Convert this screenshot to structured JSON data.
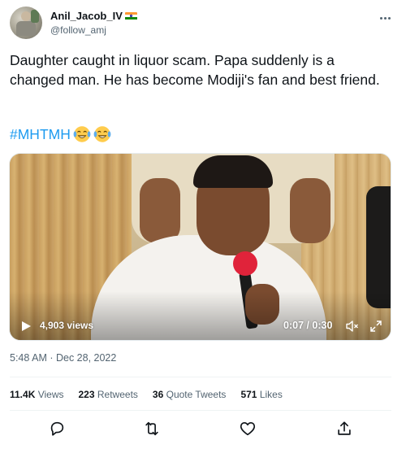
{
  "tweet": {
    "author": {
      "display_name": "Anil_Jacob_IV",
      "handle": "@follow_amj",
      "flag_icon": "india-flag-icon"
    },
    "text": "Daughter caught in liquor scam. Papa suddenly is a changed man. He has become Modiji's fan and best friend.",
    "hashtag": "#MHTMH",
    "emojis": [
      "face-with-tears-of-joy",
      "face-with-tears-of-joy"
    ],
    "video": {
      "views": "4,903 views",
      "timecode": "0:07 / 0:30"
    },
    "timestamp": "5:48 AM · Dec 28, 2022",
    "stats": [
      {
        "value": "11.4K",
        "label": "Views"
      },
      {
        "value": "223",
        "label": "Retweets"
      },
      {
        "value": "36",
        "label": "Quote Tweets"
      },
      {
        "value": "571",
        "label": "Likes"
      }
    ]
  },
  "colors": {
    "hashtag": "#1d9bf0",
    "secondary_text": "#536471",
    "primary_text": "#0f1419"
  }
}
